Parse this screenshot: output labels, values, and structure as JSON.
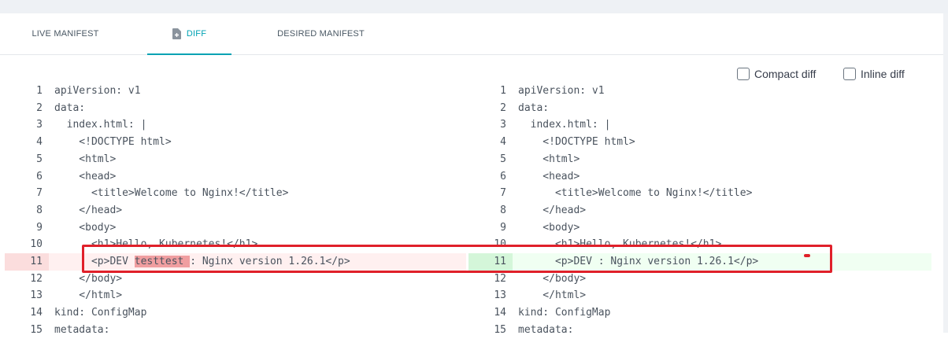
{
  "tabs": [
    {
      "label": "LIVE MANIFEST",
      "active": false
    },
    {
      "label": "DIFF",
      "active": true,
      "icon": "diff-file-icon"
    },
    {
      "label": "DESIRED MANIFEST",
      "active": false
    }
  ],
  "options": {
    "compact_diff": {
      "label": "Compact diff",
      "checked": false
    },
    "inline_diff": {
      "label": "Inline diff",
      "checked": false
    }
  },
  "colors": {
    "accent": "#00a2b3",
    "deleted_line_bg": "#fff0f0",
    "added_line_bg": "#f0fff2",
    "deleted_word_bg": "#f09ea0",
    "annotation_red": "#e0202a"
  },
  "left_pane": {
    "lines": [
      {
        "n": "1",
        "text": "apiVersion: v1"
      },
      {
        "n": "2",
        "text": "data:"
      },
      {
        "n": "3",
        "text": "  index.html: |"
      },
      {
        "n": "4",
        "text": "    <!DOCTYPE html>"
      },
      {
        "n": "5",
        "text": "    <html>"
      },
      {
        "n": "6",
        "text": "    <head>"
      },
      {
        "n": "7",
        "text": "      <title>Welcome to Nginx!</title>"
      },
      {
        "n": "8",
        "text": "    </head>"
      },
      {
        "n": "9",
        "text": "    <body>"
      },
      {
        "n": "10",
        "text": "      <h1>Hello, Kubernetes!</h1>"
      },
      {
        "n": "11",
        "text_before": "      <p>DEV ",
        "text_removed": "testtest ",
        "text_after": ": Nginx version 1.26.1</p>",
        "status": "deleted"
      },
      {
        "n": "12",
        "text": "    </body>"
      },
      {
        "n": "13",
        "text": "    </html>"
      },
      {
        "n": "14",
        "text": "kind: ConfigMap"
      },
      {
        "n": "15",
        "text": "metadata:"
      }
    ]
  },
  "right_pane": {
    "lines": [
      {
        "n": "1",
        "text": "apiVersion: v1"
      },
      {
        "n": "2",
        "text": "data:"
      },
      {
        "n": "3",
        "text": "  index.html: |"
      },
      {
        "n": "4",
        "text": "    <!DOCTYPE html>"
      },
      {
        "n": "5",
        "text": "    <html>"
      },
      {
        "n": "6",
        "text": "    <head>"
      },
      {
        "n": "7",
        "text": "      <title>Welcome to Nginx!</title>"
      },
      {
        "n": "8",
        "text": "    </head>"
      },
      {
        "n": "9",
        "text": "    <body>"
      },
      {
        "n": "10",
        "text": "      <h1>Hello, Kubernetes!</h1>"
      },
      {
        "n": "11",
        "text": "      <p>DEV : Nginx version 1.26.1</p>",
        "status": "added"
      },
      {
        "n": "12",
        "text": "    </body>"
      },
      {
        "n": "13",
        "text": "    </html>"
      },
      {
        "n": "14",
        "text": "kind: ConfigMap"
      },
      {
        "n": "15",
        "text": "metadata:"
      }
    ]
  }
}
